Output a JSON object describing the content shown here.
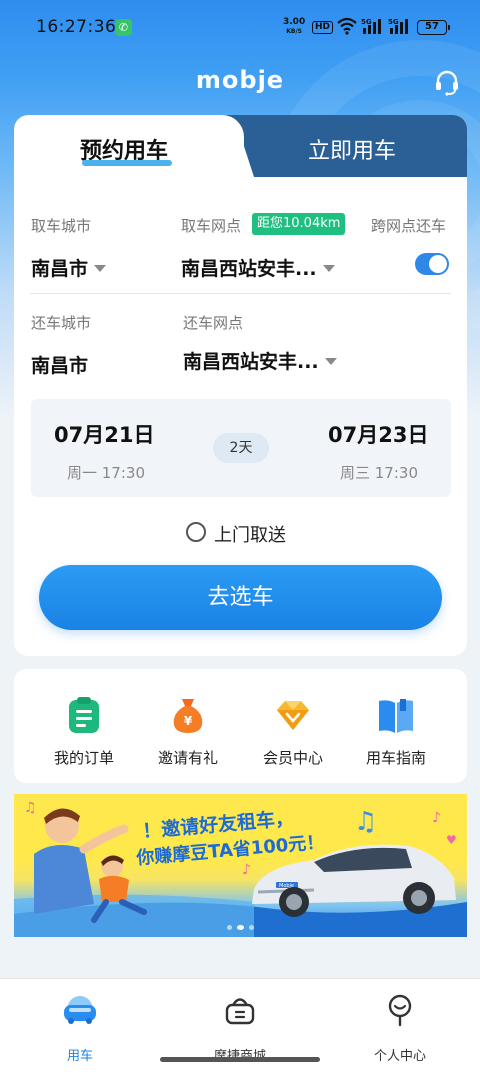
{
  "status_bar": {
    "time": "16:27:36",
    "net_speed_value": "3.00",
    "net_speed_unit": "KB/S",
    "hd_label": "HD",
    "sig1_label": "5G",
    "sig2_label": "5G",
    "battery": "57"
  },
  "header": {
    "brand": "mobje",
    "support_icon": "headset-icon"
  },
  "booking": {
    "tabs": [
      {
        "label": "预约用车",
        "active": true
      },
      {
        "label": "立即用车",
        "active": false
      }
    ],
    "pickup_city_label": "取车城市",
    "pickup_city": "南昌市",
    "pickup_point_label": "取车网点",
    "distance_badge": "距您10.04km",
    "pickup_point": "南昌西站安丰...",
    "cross_return_label": "跨网点还车",
    "cross_return_enabled": true,
    "return_city_label": "还车城市",
    "return_city": "南昌市",
    "return_point_label": "还车网点",
    "return_point": "南昌西站安丰...",
    "start_date": "07月21日",
    "start_time": "周一 17:30",
    "duration": "2天",
    "end_date": "07月23日",
    "end_time": "周三 17:30",
    "door_delivery_label": "上门取送",
    "go_button": "去选车"
  },
  "shortcuts": [
    {
      "label": "我的订单",
      "icon": "clipboard-icon"
    },
    {
      "label": "邀请有礼",
      "icon": "money-bag-icon"
    },
    {
      "label": "会员中心",
      "icon": "diamond-icon"
    },
    {
      "label": "用车指南",
      "icon": "book-icon"
    }
  ],
  "banner": {
    "line1": "！邀请好友租车，",
    "line2": "你赚摩豆TA省100元！",
    "car_plate": "Mobje"
  },
  "bottom_nav": [
    {
      "label": "用车",
      "icon": "car-icon",
      "active": true
    },
    {
      "label": "摩捷商城",
      "icon": "shopping-basket-icon",
      "active": false
    },
    {
      "label": "个人中心",
      "icon": "person-icon",
      "active": false
    }
  ],
  "colors": {
    "accent": "#1a82e6",
    "tab_bar": "#2a6096",
    "distance_badge": "#1fbf82"
  }
}
